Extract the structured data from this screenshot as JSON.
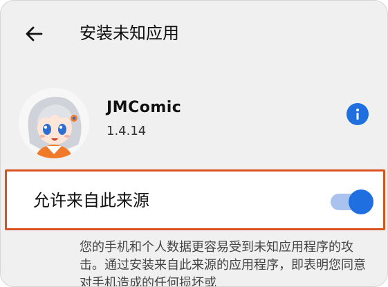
{
  "header": {
    "title": "安装未知应用",
    "back_icon": "arrow-left-icon"
  },
  "app": {
    "name": "JMComic",
    "version": "1.4.14",
    "avatar_icon": "anime-girl-avatar",
    "info_icon": "info-icon"
  },
  "setting": {
    "label": "允许来自此来源",
    "enabled": true,
    "highlight_color": "#d9531e"
  },
  "description": "您的手机和个人数据更容易受到未知应用程序的攻击。通过安装来自此来源的应用程序，即表明您同意对手机造成的任何损坏或",
  "colors": {
    "accent": "#1f6fe0",
    "track": "#a9c3ee",
    "background": "#f0f0f0"
  }
}
